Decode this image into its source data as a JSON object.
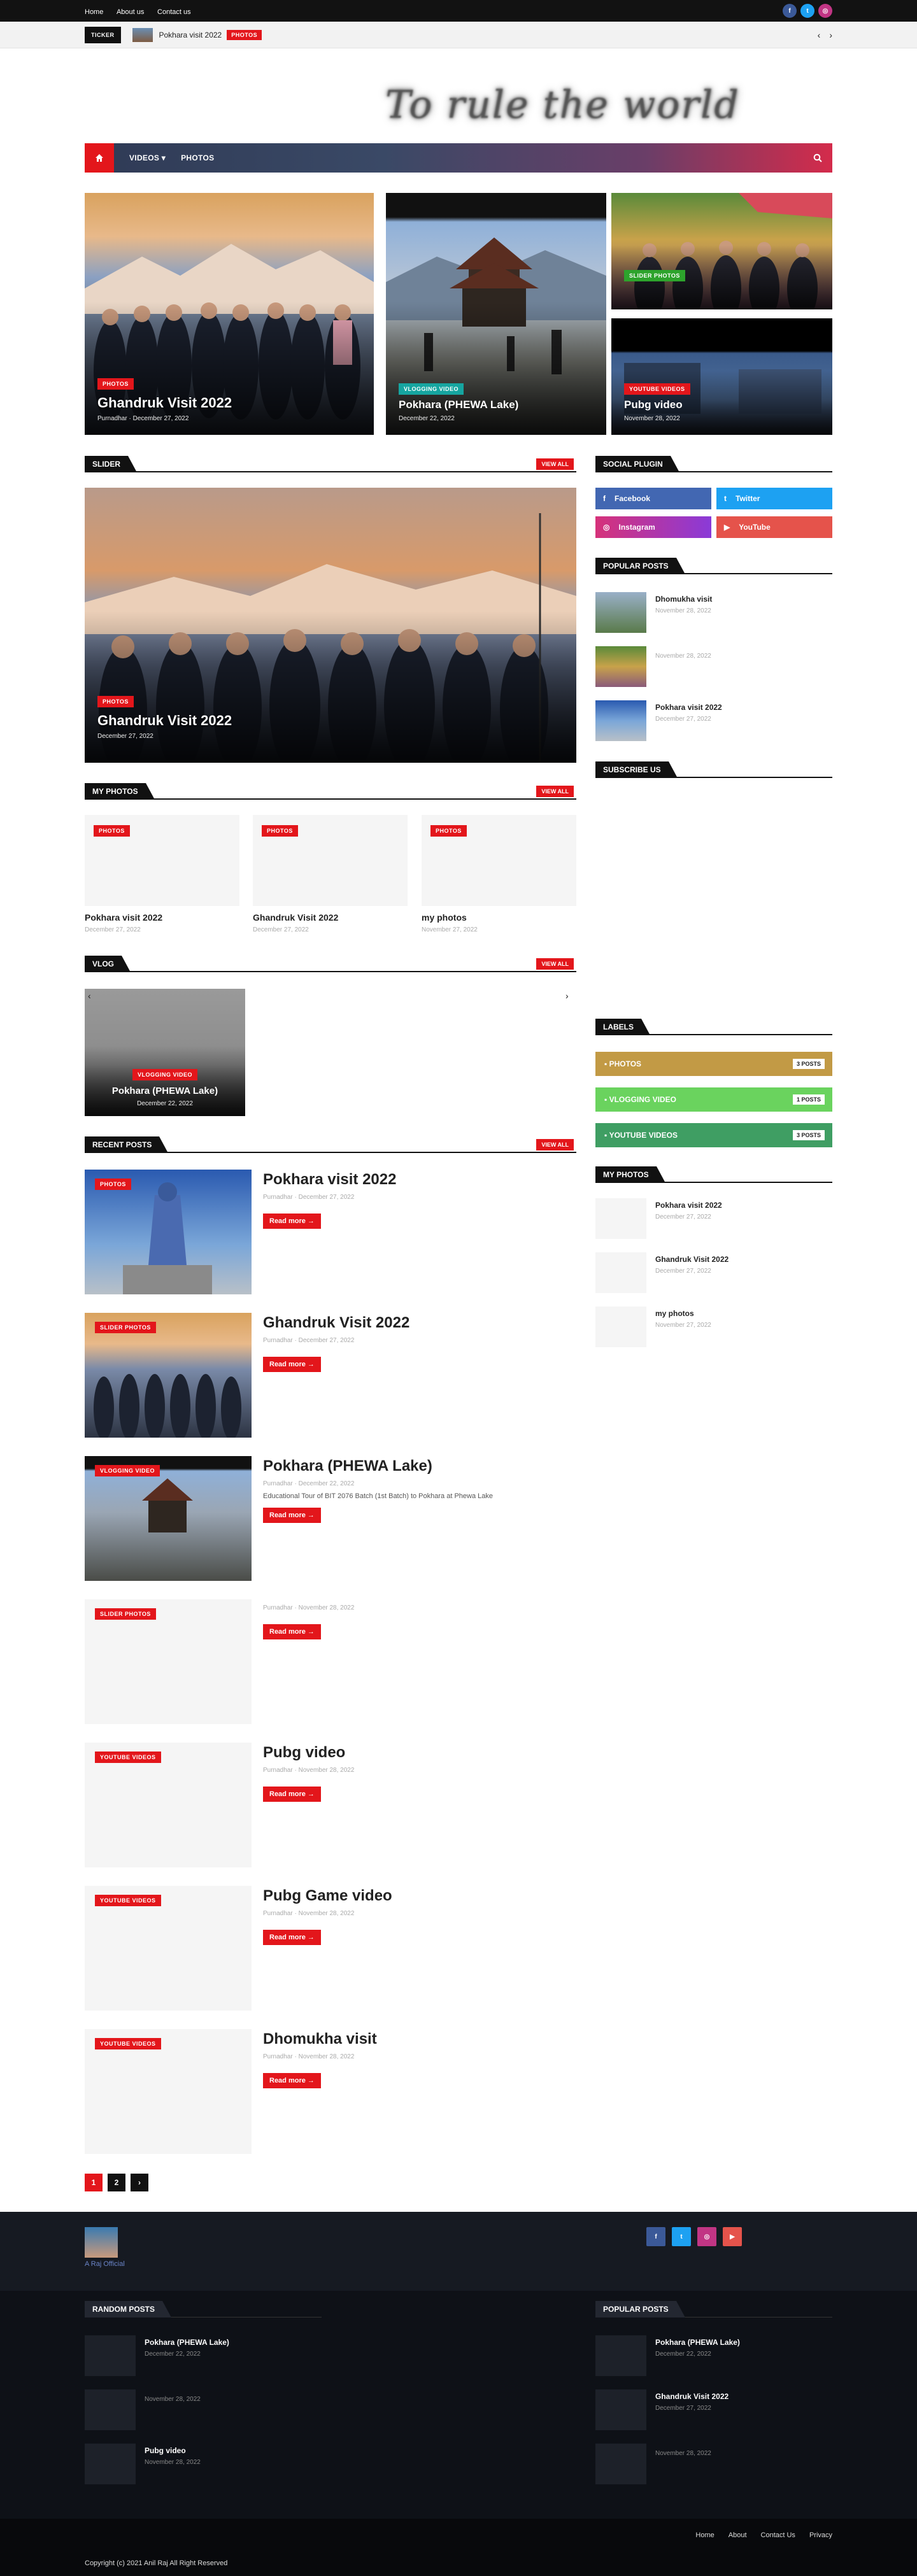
{
  "topbar": {
    "links": [
      "Home",
      "About us",
      "Contact us"
    ],
    "social": [
      {
        "icon": "facebook-icon",
        "glyph": "f",
        "color": "#3b5998"
      },
      {
        "icon": "twitter-icon",
        "glyph": "t",
        "color": "#1da1f2"
      },
      {
        "icon": "instagram-icon",
        "glyph": "◎",
        "color": "#c13584"
      }
    ]
  },
  "ticker": {
    "label": "TICKER",
    "title": "Pokhara visit 2022",
    "badge": "PHOTOS"
  },
  "logo": {
    "text": "To rule the world"
  },
  "nav": {
    "items": [
      "VIDEOS",
      "PHOTOS"
    ]
  },
  "hero": [
    {
      "badge": "PHOTOS",
      "title": "Ghandruk Visit 2022",
      "author": "Purnadhar",
      "date": "December 27, 2022"
    },
    {
      "badge": "VLOGGING VIDEO",
      "title": "Pokhara (PHEWA Lake)",
      "date": "December 22, 2022"
    },
    {
      "badge": "SLIDER PHOTOS"
    },
    {
      "badge": "YOUTUBE VIDEOS",
      "title": "Pubg video",
      "date": "November 28, 2022"
    }
  ],
  "slider": {
    "heading": "SLIDER",
    "view_all": "VIEW ALL",
    "badge": "PHOTOS",
    "title": "Ghandruk Visit 2022",
    "date": "December 27, 2022"
  },
  "my_photos": {
    "heading": "MY PHOTOS",
    "view_all": "VIEW ALL",
    "items": [
      {
        "badge": "PHOTOS",
        "title": "Pokhara visit 2022",
        "date": "December 27, 2022"
      },
      {
        "badge": "PHOTOS",
        "title": "Ghandruk Visit 2022",
        "date": "December 27, 2022"
      },
      {
        "badge": "PHOTOS",
        "title": "my photos",
        "date": "November 27, 2022"
      }
    ]
  },
  "vlog": {
    "heading": "VLOG",
    "view_all": "VIEW ALL",
    "badge": "VLOGGING VIDEO",
    "title": "Pokhara (PHEWA Lake)",
    "date": "December 22, 2022"
  },
  "recent": {
    "heading": "RECENT POSTS",
    "view_all": "VIEW ALL",
    "read_more": "Read more",
    "posts": [
      {
        "badge": "PHOTOS",
        "title": "Pokhara visit 2022",
        "author": "Purnadhar",
        "date": "December 27, 2022",
        "excerpt": ""
      },
      {
        "badge": "SLIDER PHOTOS",
        "title": "Ghandruk Visit 2022",
        "author": "Purnadhar",
        "date": "December 27, 2022",
        "excerpt": ""
      },
      {
        "badge": "VLOGGING VIDEO",
        "title": "Pokhara (PHEWA Lake)",
        "author": "Purnadhar",
        "date": "December 22, 2022",
        "excerpt": "Educational Tour of BIT 2076 Batch (1st Batch) to Pokhara at Phewa Lake"
      },
      {
        "badge": "SLIDER PHOTOS",
        "title": "",
        "author": "Purnadhar",
        "date": "November 28, 2022",
        "excerpt": ""
      },
      {
        "badge": "YOUTUBE VIDEOS",
        "title": "Pubg video",
        "author": "Purnadhar",
        "date": "November 28, 2022",
        "excerpt": ""
      },
      {
        "badge": "YOUTUBE VIDEOS",
        "title": "Pubg Game video",
        "author": "Purnadhar",
        "date": "November 28, 2022",
        "excerpt": ""
      },
      {
        "badge": "YOUTUBE VIDEOS",
        "title": "Dhomukha visit",
        "author": "Purnadhar",
        "date": "November 28, 2022",
        "excerpt": ""
      }
    ]
  },
  "pagination": [
    "1",
    "2",
    "›"
  ],
  "sidebar": {
    "social_heading": "SOCIAL PLUGIN",
    "social": [
      {
        "label": "Facebook",
        "icon": "facebook-icon",
        "glyph": "f",
        "color": "#4267b2"
      },
      {
        "label": "Twitter",
        "icon": "twitter-icon",
        "glyph": "t",
        "color": "#1da1f2"
      },
      {
        "label": "Instagram",
        "icon": "instagram-icon",
        "glyph": "◎",
        "color": "#b43ab0"
      },
      {
        "label": "YouTube",
        "icon": "youtube-icon",
        "glyph": "▶",
        "color": "#e5534b"
      }
    ],
    "popular_heading": "POPULAR POSTS",
    "popular": [
      {
        "title": "Dhomukha visit",
        "date": "November 28, 2022"
      },
      {
        "title": "",
        "date": "November 28, 2022"
      },
      {
        "title": "Pokhara visit 2022",
        "date": "December 27, 2022"
      }
    ],
    "subscribe_heading": "SUBSCRIBE US",
    "labels_heading": "LABELS",
    "labels": [
      {
        "name": "PHOTOS",
        "count": "3 POSTS",
        "color": "#c29a45"
      },
      {
        "name": "VLOGGING VIDEO",
        "count": "1 POSTS",
        "color": "#6ad35e"
      },
      {
        "name": "YOUTUBE VIDEOS",
        "count": "3 POSTS",
        "color": "#3f9e63"
      }
    ],
    "my_photos_heading": "MY PHOTOS",
    "my_photos": [
      {
        "title": "Pokhara visit 2022",
        "date": "December 27, 2022"
      },
      {
        "title": "Ghandruk Visit 2022",
        "date": "December 27, 2022"
      },
      {
        "title": "my photos",
        "date": "November 27, 2022"
      }
    ]
  },
  "footer": {
    "brand": "A Raj Official",
    "social": [
      {
        "icon": "facebook-icon",
        "glyph": "f",
        "color": "#3b5998"
      },
      {
        "icon": "twitter-icon",
        "glyph": "t",
        "color": "#1da1f2"
      },
      {
        "icon": "instagram-icon",
        "glyph": "◎",
        "color": "#c13584"
      },
      {
        "icon": "youtube-icon",
        "glyph": "▶",
        "color": "#e5534b"
      }
    ],
    "random_heading": "RANDOM POSTS",
    "random": [
      {
        "title": "Pokhara (PHEWA Lake)",
        "date": "December 22, 2022"
      },
      {
        "title": "",
        "date": "November 28, 2022"
      },
      {
        "title": "Pubg video",
        "date": "November 28, 2022"
      }
    ],
    "popular_heading": "POPULAR POSTS",
    "popular": [
      {
        "title": "Pokhara (PHEWA Lake)",
        "date": "December 22, 2022"
      },
      {
        "title": "Ghandruk Visit 2022",
        "date": "December 27, 2022"
      },
      {
        "title": "",
        "date": "November 28, 2022"
      }
    ],
    "links": [
      "Home",
      "About",
      "Contact Us",
      "Privacy"
    ],
    "copyright": "Copyright (c) 2021 Anil Raj All Right Reserved"
  },
  "colors": {
    "accent": "#e3161b",
    "dark": "#111111"
  }
}
